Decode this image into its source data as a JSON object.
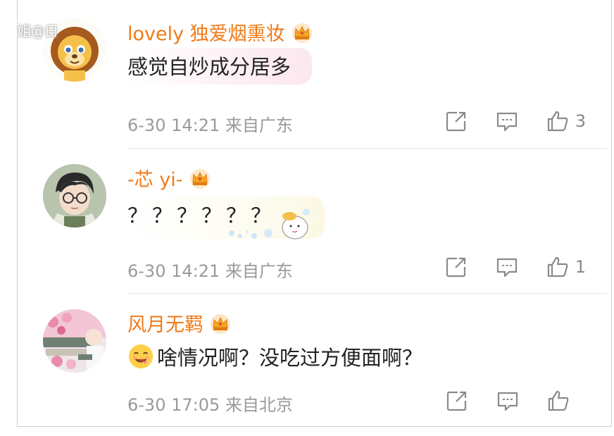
{
  "watermark": "姐@日",
  "comments": [
    {
      "username": "lovely 独爱烟熏妆",
      "text": "感觉自炒成分居多",
      "time": "6-30 14:21",
      "location": "来自广东",
      "likes": "3",
      "avatar": "lion-avatar"
    },
    {
      "username": "-芯 yi-",
      "text": "？？？？？？",
      "time": "6-30 14:21",
      "location": "来自广东",
      "likes": "1",
      "avatar": "anime-boy-avatar"
    },
    {
      "username": "风月无羁",
      "text": "啥情况啊？没吃过方便面啊？",
      "time": "6-30 17:05",
      "location": "来自北京",
      "likes": "",
      "avatar": "photo-avatar"
    }
  ],
  "icons": {
    "crown": "crown-badge-icon",
    "share": "share-icon",
    "comment": "comment-icon",
    "like": "like-icon",
    "emoji": "yum-emoji-icon"
  },
  "colors": {
    "username": "#f07a17",
    "meta": "#9a9a9a",
    "text": "#222222",
    "icon": "#8a8a8a"
  }
}
